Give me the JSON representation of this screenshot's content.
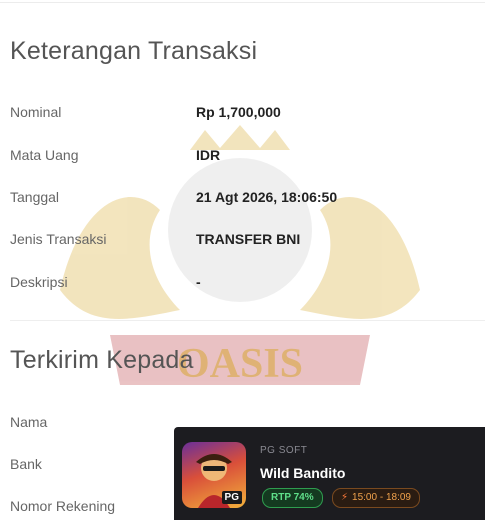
{
  "transaction": {
    "title": "Keterangan Transaksi",
    "rows": [
      {
        "label": "Nominal",
        "value": "Rp 1,700,000"
      },
      {
        "label": "Mata Uang",
        "value": "IDR"
      },
      {
        "label": "Tanggal",
        "value": "21 Agt 2026, 18:06:50"
      },
      {
        "label": "Jenis Transaksi",
        "value": "TRANSFER BNI"
      },
      {
        "label": "Deskripsi",
        "value": "-"
      }
    ]
  },
  "recipient": {
    "title": "Terkirim Kepada",
    "rows": [
      {
        "label": "Nama"
      },
      {
        "label": "Bank"
      },
      {
        "label": "Nomor Rekening"
      }
    ]
  },
  "watermark": {
    "text": "OASIS"
  },
  "game_card": {
    "provider": "PG SOFT",
    "name": "Wild Bandito",
    "rtp": "RTP 74%",
    "time": "15:00 - 18:09",
    "badge": "PG",
    "icons": [
      "bolt-icon"
    ]
  }
}
